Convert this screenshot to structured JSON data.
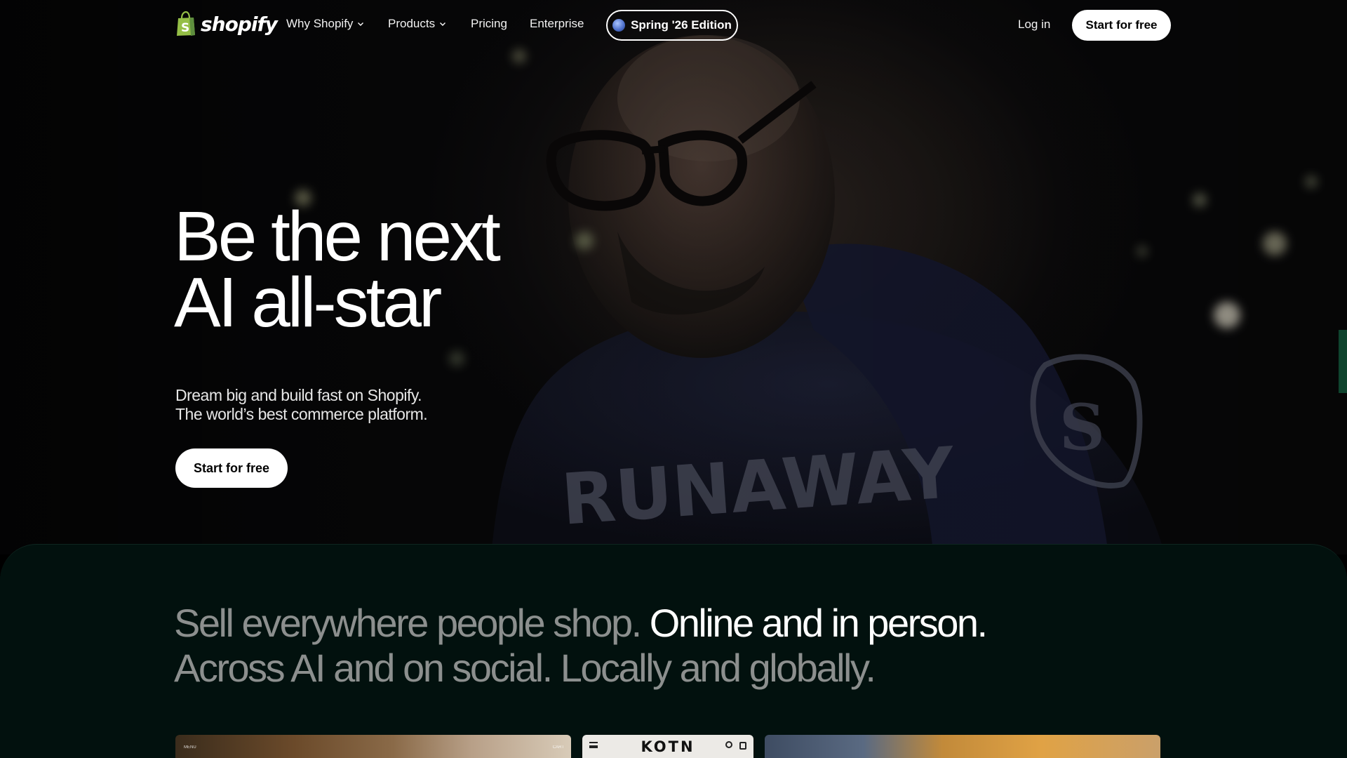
{
  "nav": {
    "brand": "shopify",
    "links": [
      {
        "label": "Why Shopify",
        "has_dropdown": true
      },
      {
        "label": "Products",
        "has_dropdown": true
      },
      {
        "label": "Pricing",
        "has_dropdown": false
      },
      {
        "label": "Enterprise",
        "has_dropdown": false
      }
    ],
    "edition_label": "Spring '26 Edition",
    "login_label": "Log in",
    "cta_label": "Start for free"
  },
  "hero": {
    "headline_line1": "Be the next",
    "headline_line2": "AI all-star",
    "subhead_line1": "Dream big and build fast on Shopify.",
    "subhead_line2": "The world’s best commerce platform.",
    "cta_label": "Start for free"
  },
  "section": {
    "sell_part1": "Sell everywhere people shop.",
    "sell_part2": " Online and in person.",
    "sell_part3": "Across AI and on social. Locally and globally."
  },
  "cards": {
    "card1_menu": "MENU",
    "card1_cart": "CART",
    "card2_brand": "KOTN"
  },
  "colors": {
    "brand_green": "#95bf47",
    "section_bg": "#02110e"
  }
}
